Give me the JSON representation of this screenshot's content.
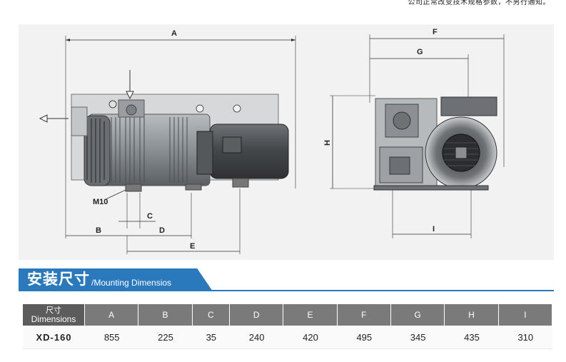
{
  "top_note": "公司正常改变技术规格参数，不另行通知。",
  "drawing": {
    "labels": {
      "A": "A",
      "B": "B",
      "C": "C",
      "D": "D",
      "E": "E",
      "F": "F",
      "G": "G",
      "H": "H",
      "I": "I",
      "M10": "M10"
    },
    "colors": {
      "background": "#f2f2f2",
      "body": "#8d9296",
      "dark": "#4a4d50"
    }
  },
  "section": {
    "title_cn": "安装尺寸",
    "title_en": "/Mounting Dimensios",
    "accent_color": "#2b79bd"
  },
  "table": {
    "header_first_line1": "尺寸",
    "header_first_line2": "Dimensions",
    "columns": [
      "A",
      "B",
      "C",
      "D",
      "E",
      "F",
      "G",
      "H",
      "I"
    ],
    "rows": [
      {
        "model": "XD-160",
        "values": [
          "855",
          "225",
          "35",
          "240",
          "420",
          "495",
          "345",
          "435",
          "310"
        ]
      }
    ]
  }
}
